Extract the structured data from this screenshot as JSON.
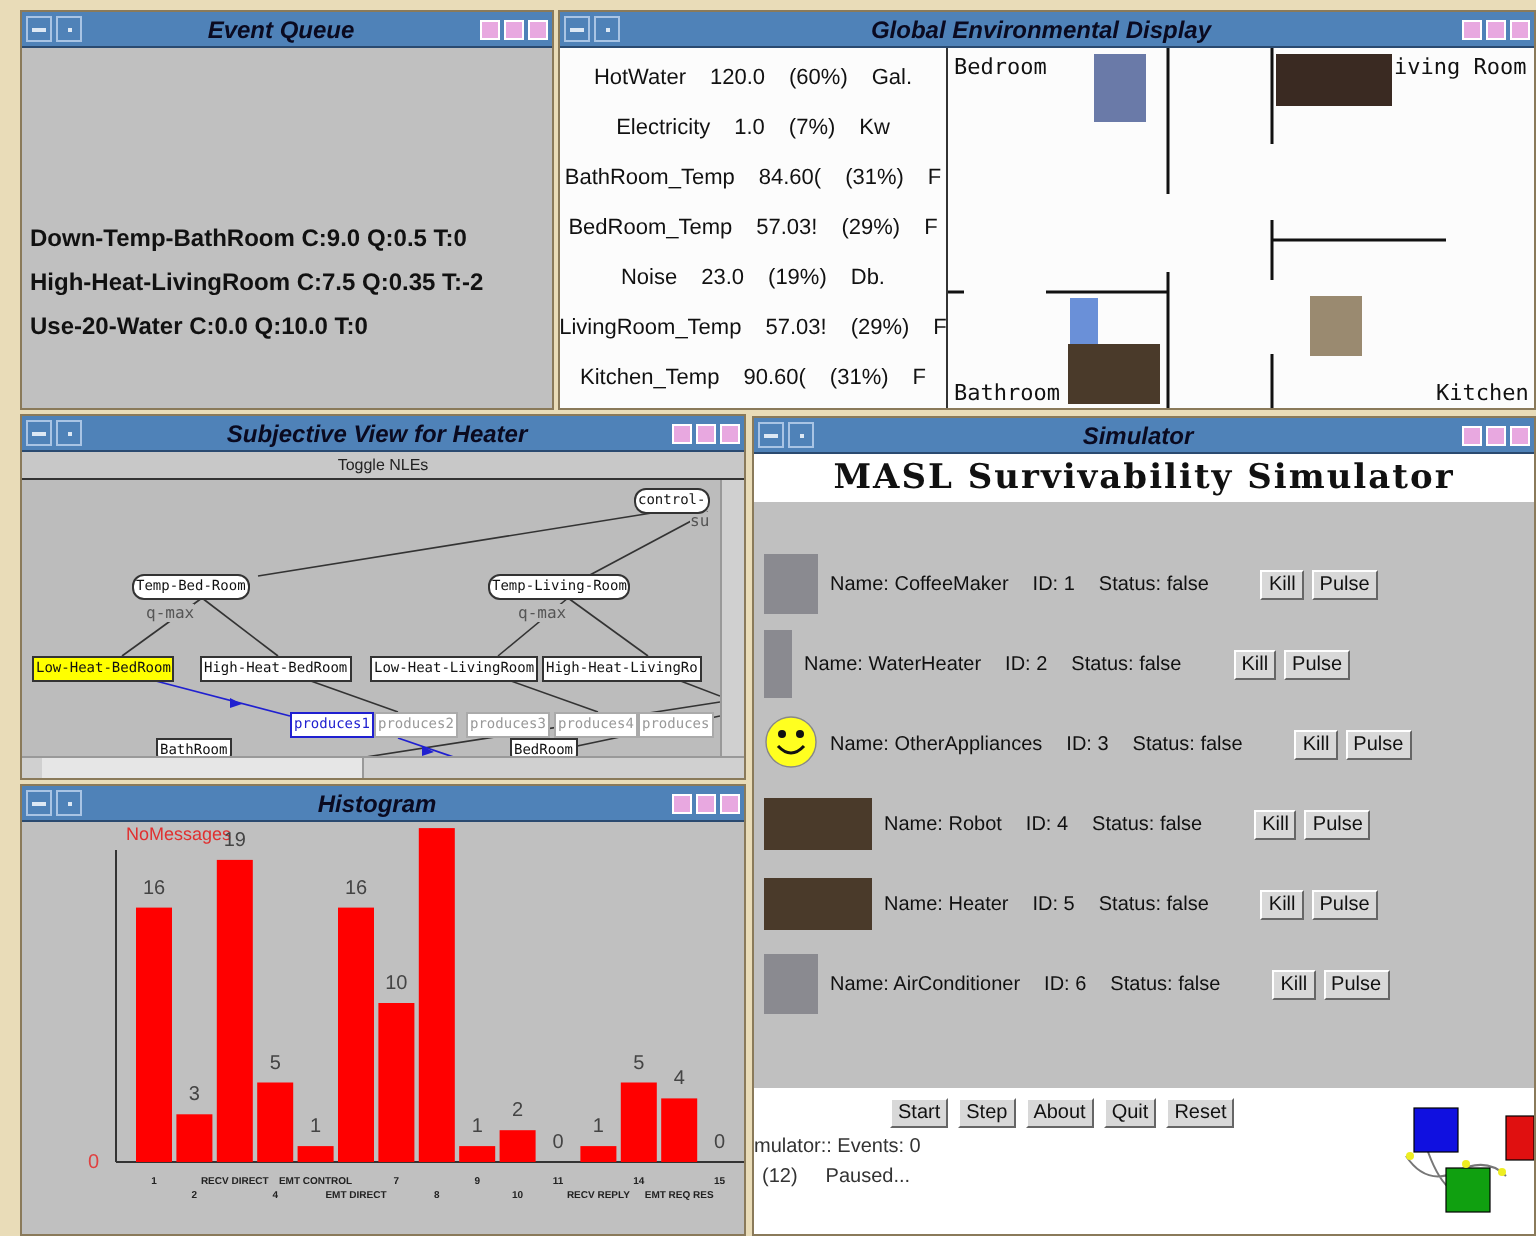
{
  "event_queue": {
    "title": "Event Queue",
    "events": [
      "Down-Temp-BathRoom C:9.0 Q:0.5 T:0",
      "High-Heat-LivingRoom C:7.5 Q:0.35 T:-2",
      "Use-20-Water C:0.0 Q:10.0 T:0"
    ]
  },
  "environment": {
    "title": "Global Environmental Display",
    "readings": [
      {
        "name": "HotWater",
        "value": "120.0",
        "percent": "(60%)",
        "unit": "Gal."
      },
      {
        "name": "Electricity",
        "value": "1.0",
        "percent": "(7%)",
        "unit": "Kw"
      },
      {
        "name": "BathRoom_Temp",
        "value": "84.60(",
        "percent": "(31%)",
        "unit": "F"
      },
      {
        "name": "BedRoom_Temp",
        "value": "57.03!",
        "percent": "(29%)",
        "unit": "F"
      },
      {
        "name": "Noise",
        "value": "23.0",
        "percent": "(19%)",
        "unit": "Db."
      },
      {
        "name": "LivingRoom_Temp",
        "value": "57.03!",
        "percent": "(29%)",
        "unit": "F"
      },
      {
        "name": "Kitchen_Temp",
        "value": "90.60(",
        "percent": "(31%)",
        "unit": "F"
      }
    ],
    "rooms": [
      "Bedroom",
      "iving Room",
      "Bathroom",
      "Kitchen"
    ]
  },
  "subjective_view": {
    "title": "Subjective View for Heater",
    "toolbar_button": "Toggle NLEs",
    "nodes": [
      {
        "label": "control-",
        "kind": "task",
        "selected": false
      },
      {
        "label": "Temp-Bed-Room",
        "kind": "task",
        "selected": false
      },
      {
        "label": "Temp-Living-Room",
        "kind": "task",
        "selected": false
      },
      {
        "label": "Low-Heat-BedRoom",
        "kind": "method",
        "selected": true
      },
      {
        "label": "High-Heat-BedRoom",
        "kind": "method",
        "selected": false
      },
      {
        "label": "Low-Heat-LivingRoom",
        "kind": "method",
        "selected": false
      },
      {
        "label": "High-Heat-LivingRo",
        "kind": "method",
        "selected": false
      },
      {
        "label": "produces1",
        "kind": "nle",
        "selected": true
      },
      {
        "label": "produces2",
        "kind": "nle",
        "selected": false
      },
      {
        "label": "produces3",
        "kind": "nle",
        "selected": false
      },
      {
        "label": "produces4",
        "kind": "nle",
        "selected": false
      },
      {
        "label": "produces",
        "kind": "nle",
        "selected": false
      },
      {
        "label": "BathRoom",
        "kind": "resource",
        "selected": false
      },
      {
        "label": "BedRoom",
        "kind": "resource",
        "selected": false
      }
    ],
    "annotations": [
      "q-max",
      "q-max",
      "su"
    ]
  },
  "histogram": {
    "title": "Histogram",
    "chart_data": {
      "type": "bar",
      "title": "NoMessages",
      "categories": [
        "1",
        "2",
        "RECV DIRECT",
        "4",
        "EMT CONTROL",
        "EMT DIRECT",
        "7",
        "8",
        "9",
        "10",
        "11",
        "RECV REPLY",
        "14",
        "EMT REQ RES",
        "15"
      ],
      "values": [
        16,
        3,
        19,
        5,
        1,
        16,
        10,
        21,
        1,
        2,
        0,
        1,
        5,
        4,
        0
      ],
      "value_labels": [
        "16",
        "3",
        "19",
        "5",
        "1",
        "16",
        "10",
        null,
        "1",
        "2",
        "0",
        "1",
        "5",
        "4",
        "0"
      ],
      "annotations": [
        {
          "text": "0"
        }
      ]
    }
  },
  "simulator": {
    "title": "Simulator",
    "heading": "MASL Survivability Simulator",
    "devices": [
      {
        "kind": "photo",
        "name": "Name: CoffeeMaker",
        "id": "ID: 1",
        "status": "Status: false",
        "buttons": [
          "Kill",
          "Pulse"
        ]
      },
      {
        "kind": "narrow",
        "name": "Name: WaterHeater",
        "id": "ID: 2",
        "status": "Status: false",
        "buttons": [
          "Kill",
          "Pulse"
        ]
      },
      {
        "kind": "smiley",
        "name": "Name: OtherAppliances",
        "id": "ID: 3",
        "status": "Status: false",
        "buttons": [
          "Kill",
          "Pulse"
        ]
      },
      {
        "kind": "wide",
        "name": "Name: Robot",
        "id": "ID: 4",
        "status": "Status: false",
        "buttons": [
          "Kill",
          "Pulse"
        ]
      },
      {
        "kind": "wide",
        "name": "Name: Heater",
        "id": "ID: 5",
        "status": "Status: false",
        "buttons": [
          "Kill",
          "Pulse"
        ]
      },
      {
        "kind": "photo",
        "name": "Name: AirConditioner",
        "id": "ID: 6",
        "status": "Status: false",
        "buttons": [
          "Kill",
          "Pulse"
        ]
      }
    ],
    "controls": [
      "Start",
      "Step",
      "About",
      "Quit",
      "Reset"
    ],
    "events_text": "mulator:: Events: 0",
    "count": "(12)",
    "state": "Paused..."
  }
}
